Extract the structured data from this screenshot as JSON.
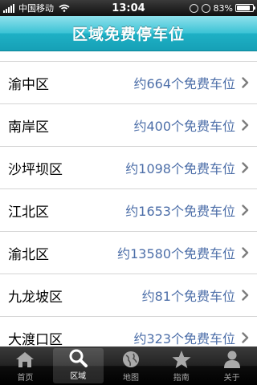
{
  "status_bar": {
    "carrier": "中国移动",
    "time": "13:04",
    "battery": "83%",
    "battery_level": 0.83
  },
  "nav": {
    "title": "区域免费停车位"
  },
  "districts": [
    {
      "name": "渝中区",
      "count": "约664个免费车位"
    },
    {
      "name": "南岸区",
      "count": "约400个免费车位"
    },
    {
      "name": "沙坪坝区",
      "count": "约1098个免费车位"
    },
    {
      "name": "江北区",
      "count": "约1653个免费车位"
    },
    {
      "name": "渝北区",
      "count": "约13580个免费车位"
    },
    {
      "name": "九龙坡区",
      "count": "约81个免费车位"
    },
    {
      "name": "大渡口区",
      "count": "约323个免费车位"
    }
  ],
  "tabs": [
    {
      "label": "首页",
      "icon": "home-icon"
    },
    {
      "label": "区域",
      "icon": "search-icon",
      "selected": true
    },
    {
      "label": "地图",
      "icon": "globe-icon"
    },
    {
      "label": "指南",
      "icon": "star-icon"
    },
    {
      "label": "关于",
      "icon": "person-icon"
    }
  ],
  "colors": {
    "nav_bar": "#1eb0c5",
    "count_text": "#4c6ea8",
    "tab_bar": "#000000"
  }
}
